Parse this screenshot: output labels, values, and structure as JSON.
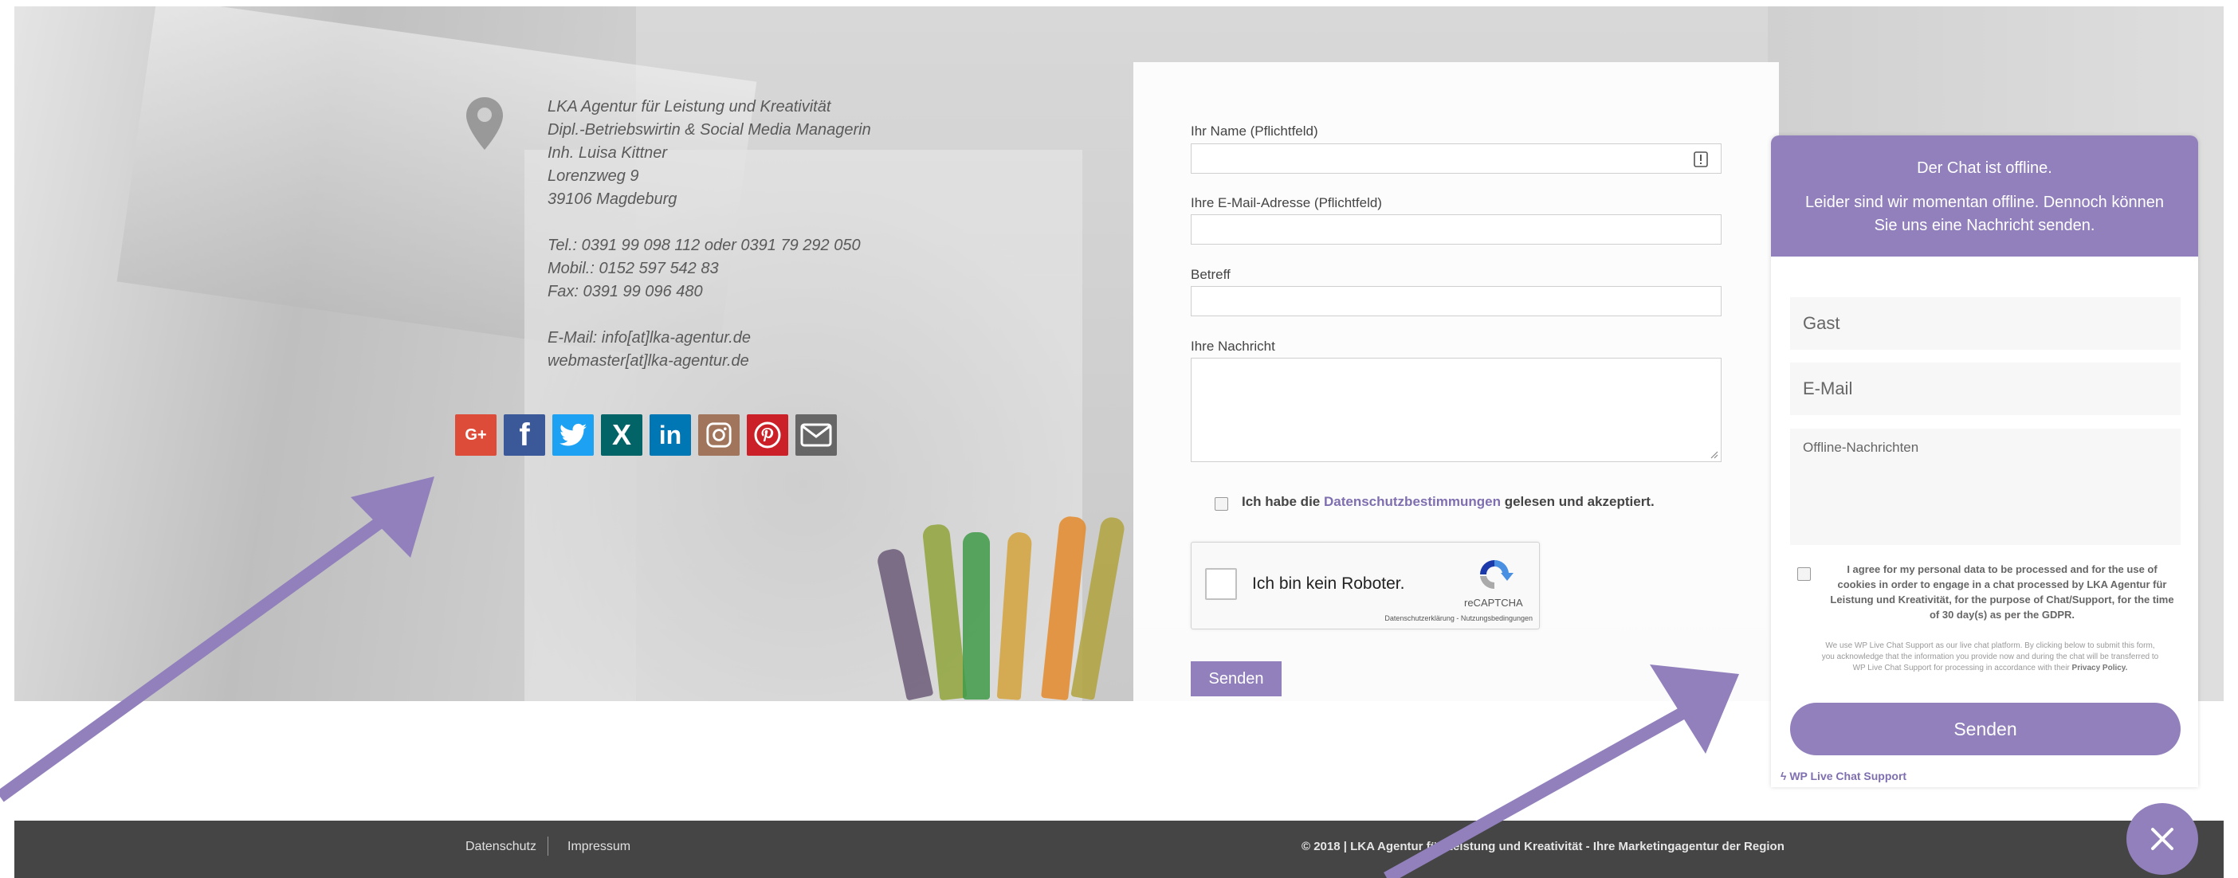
{
  "address": {
    "lines": [
      "LKA Agentur für Leistung und Kreativität",
      "Dipl.-Betriebswirtin & Social Media Managerin",
      "Inh. Luisa Kittner",
      "Lorenzweg 9",
      "39106 Magdeburg"
    ],
    "phone": "Tel.: 0391 99 098 112 oder 0391 79 292 050",
    "mobile": "Mobil.: 0152 597 542 83",
    "fax": "Fax: 0391 99 096 480",
    "email": "E-Mail: info[at]lka-agentur.de",
    "email2": "webmaster[at]lka-agentur.de"
  },
  "social": [
    {
      "icon": "google-plus-icon",
      "glyph": "G+",
      "color": "#dd4b39"
    },
    {
      "icon": "facebook-icon",
      "glyph": "f",
      "color": "#3b5998"
    },
    {
      "icon": "twitter-icon",
      "glyph": "🐦",
      "color": "#1da1f2"
    },
    {
      "icon": "xing-icon",
      "glyph": "X",
      "color": "#026466"
    },
    {
      "icon": "linkedin-icon",
      "glyph": "in",
      "color": "#0077b5"
    },
    {
      "icon": "instagram-icon",
      "glyph": "◎",
      "color": "#a1755c"
    },
    {
      "icon": "pinterest-icon",
      "glyph": "P",
      "color": "#cb2027"
    },
    {
      "icon": "mail-icon",
      "glyph": "✉",
      "color": "#666666"
    }
  ],
  "form": {
    "name_label": "Ihr Name (Pflichtfeld)",
    "email_label": "Ihre E-Mail-Adresse (Pflichtfeld)",
    "subject_label": "Betreff",
    "message_label": "Ihre Nachricht",
    "consent_prefix": "Ich habe die ",
    "consent_link": "Datenschutzbestimmungen",
    "consent_suffix": " gelesen und akzeptiert.",
    "submit": "Senden"
  },
  "recaptcha": {
    "label": "Ich bin kein Roboter.",
    "brand": "reCAPTCHA",
    "links": "Datenschutzerklärung - Nutzungsbedingungen"
  },
  "chat": {
    "status": "Der Chat ist offline.",
    "message": "Leider sind wir momentan offline. Dennoch können Sie uns eine Nachricht senden.",
    "name_placeholder": "Gast",
    "email_placeholder": "E-Mail",
    "message_placeholder": "Offline-Nachrichten",
    "gdpr": "I agree for my personal data to be processed and for the use of cookies in order to engage in a chat processed by LKA Agentur für Leistung und Kreativität, for the purpose of Chat/Support, for the time of 30 day(s) as per the GDPR.",
    "fine_print": "We use WP Live Chat Support as our live chat platform. By clicking below to submit this form, you acknowledge that the information you provide now and during the chat will be transferred to WP Live Chat Support for processing in accordance with their",
    "fine_print_link": "Privacy Policy.",
    "submit": "Senden",
    "powered_by": "WP Live Chat Support",
    "accent_color": "#9180bc"
  },
  "footer": {
    "privacy": "Datenschutz",
    "imprint": "Impressum",
    "copyright": "© 2018 | LKA Agentur für Leistung und Kreativität - Ihre Marketingagentur der Region"
  }
}
